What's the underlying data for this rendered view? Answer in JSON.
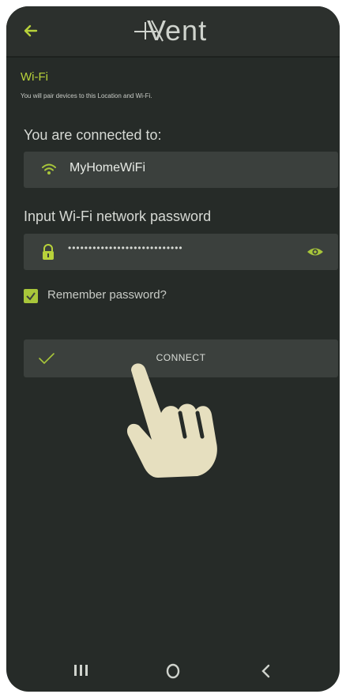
{
  "app": {
    "logo_text": "Vent"
  },
  "header": {
    "back_icon": "back-arrow-icon"
  },
  "section": {
    "title": "Wi-Fi",
    "subtitle": "You will pair devices to this Location and Wi-Fi."
  },
  "connection": {
    "label": "You are connected to:",
    "network_name": "MyHomeWiFi",
    "icon": "wifi-icon"
  },
  "password": {
    "label": "Input Wi-Fi network password",
    "masked_value": "••••••••••••••••••••••••••••",
    "lock_icon": "lock-icon",
    "reveal_icon": "eye-icon"
  },
  "remember": {
    "label": "Remember password?",
    "checked": true
  },
  "connect_button": {
    "label": "CONNECT",
    "icon": "check-icon"
  },
  "navbar": {
    "recent_icon": "recent-apps-icon",
    "home_icon": "home-icon",
    "back_icon": "nav-back-icon"
  },
  "colors": {
    "background": "#262b28",
    "accent": "#b8d23a",
    "field": "#3b403d",
    "hand": "#e6dfbf"
  }
}
